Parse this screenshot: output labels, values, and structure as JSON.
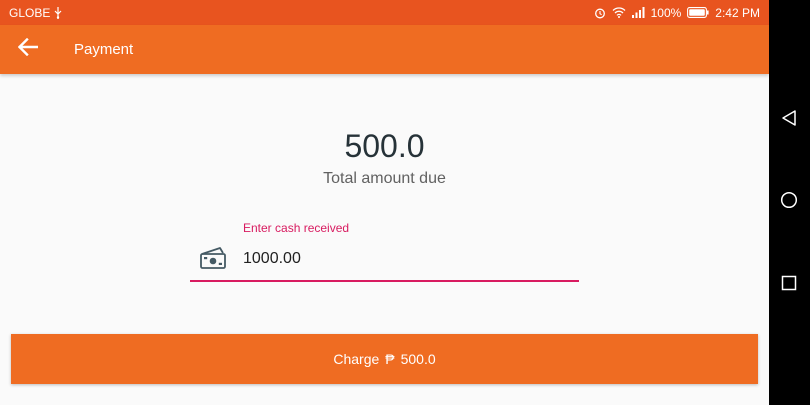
{
  "status_bar": {
    "carrier": "GLOBE",
    "battery": "100%",
    "time": "2:42 PM",
    "icons": [
      "usb-icon",
      "alarm-icon",
      "wifi-icon",
      "signal-icon",
      "battery-icon"
    ]
  },
  "app_bar": {
    "title": "Payment",
    "back_icon": "arrow-back-icon"
  },
  "payment": {
    "amount_due": "500.0",
    "amount_due_label": "Total amount due",
    "cash_label": "Enter cash received",
    "cash_value": "1000.00",
    "cash_icon": "money-icon"
  },
  "charge_button": {
    "label": "Charge",
    "currency": "₱",
    "amount": "500.0"
  },
  "nav_bar": {
    "icons": [
      "back-triangle-icon",
      "home-circle-icon",
      "recents-square-icon"
    ]
  },
  "colors": {
    "status_bar": "#e8541f",
    "app_bar": "#ef6c22",
    "accent": "#d81b60",
    "button": "#ef6c22"
  }
}
